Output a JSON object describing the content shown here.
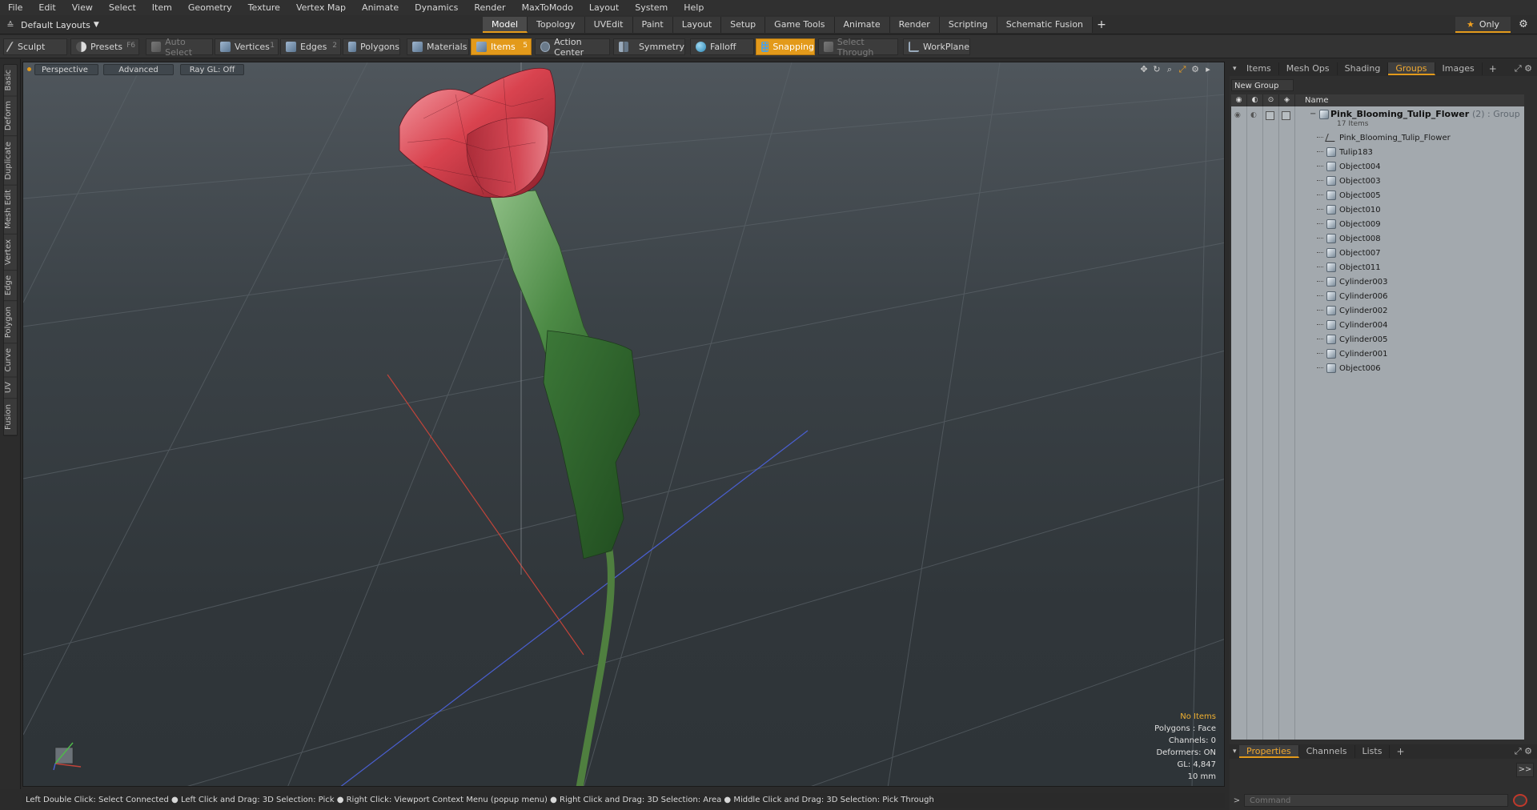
{
  "menubar": {
    "items": [
      "File",
      "Edit",
      "View",
      "Select",
      "Item",
      "Geometry",
      "Texture",
      "Vertex Map",
      "Animate",
      "Dynamics",
      "Render",
      "MaxToModo",
      "Layout",
      "System",
      "Help"
    ]
  },
  "layout": {
    "selector_label": "Default Layouts",
    "tabs": [
      "Model",
      "Topology",
      "UVEdit",
      "Paint",
      "Layout",
      "Setup",
      "Game Tools",
      "Animate",
      "Render",
      "Scripting",
      "Schematic Fusion"
    ],
    "active_tab": "Model",
    "add_tab": "+",
    "only_label": "Only"
  },
  "toolbar": {
    "sculpt": "Sculpt",
    "presets": "Presets",
    "presets_key": "F6",
    "auto_select": "Auto Select",
    "vertices": "Vertices",
    "vertices_key": "1",
    "edges": "Edges",
    "edges_key": "2",
    "polygons": "Polygons",
    "materials": "Materials",
    "items": "Items",
    "items_key": "5",
    "action_center": "Action Center",
    "symmetry": "Symmetry",
    "falloff": "Falloff",
    "snapping": "Snapping",
    "select_through": "Select Through",
    "workplane": "WorkPlane"
  },
  "left_tabs": [
    "Basic",
    "Deform",
    "Duplicate",
    "Mesh Edit",
    "Vertex",
    "Edge",
    "Polygon",
    "Curve",
    "UV",
    "Fusion"
  ],
  "viewport": {
    "view_mode": "Perspective",
    "shading": "Advanced",
    "raygl": "Ray GL: Off",
    "info": {
      "no_items": "No Items",
      "polygons": "Polygons : Face",
      "channels": "Channels: 0",
      "deformers": "Deformers: ON",
      "gl": "GL: 4,847",
      "scale": "10 mm"
    }
  },
  "statusbar": {
    "text": "Left Double Click: Select Connected ● Left Click and Drag: 3D Selection: Pick ● Right Click: Viewport Context Menu (popup menu) ● Right Click and Drag: 3D Selection: Area ● Middle Click and Drag: 3D Selection: Pick Through"
  },
  "right_panel": {
    "tabs": [
      "Items",
      "Mesh Ops",
      "Shading",
      "Groups",
      "Images"
    ],
    "active_tab": "Groups",
    "new_group": "New Group",
    "header_name": "Name",
    "group": {
      "name": "Pink_Blooming_Tulip_Flower",
      "suffix": "(2) : Group",
      "count": "17 Items"
    },
    "items": [
      {
        "name": "Pink_Blooming_Tulip_Flower",
        "icon": "mesh-icon"
      },
      {
        "name": "Tulip183",
        "icon": "cube-icon"
      },
      {
        "name": "Object004",
        "icon": "cube-icon"
      },
      {
        "name": "Object003",
        "icon": "cube-icon"
      },
      {
        "name": "Object005",
        "icon": "cube-icon"
      },
      {
        "name": "Object010",
        "icon": "cube-icon"
      },
      {
        "name": "Object009",
        "icon": "cube-icon"
      },
      {
        "name": "Object008",
        "icon": "cube-icon"
      },
      {
        "name": "Object007",
        "icon": "cube-icon"
      },
      {
        "name": "Object011",
        "icon": "cube-icon"
      },
      {
        "name": "Cylinder003",
        "icon": "cube-icon"
      },
      {
        "name": "Cylinder006",
        "icon": "cube-icon"
      },
      {
        "name": "Cylinder002",
        "icon": "cube-icon"
      },
      {
        "name": "Cylinder004",
        "icon": "cube-icon"
      },
      {
        "name": "Cylinder005",
        "icon": "cube-icon"
      },
      {
        "name": "Cylinder001",
        "icon": "cube-icon"
      },
      {
        "name": "Object006",
        "icon": "cube-icon"
      }
    ],
    "bottom_tabs": [
      "Properties",
      "Channels",
      "Lists"
    ],
    "bottom_active": "Properties",
    "expand": ">>",
    "command_placeholder": "Command"
  },
  "colors": {
    "accent": "#e39a1b",
    "list_bg": "#a3a9ae",
    "petal": "#d9434f",
    "leaf": "#3f7a3a"
  }
}
